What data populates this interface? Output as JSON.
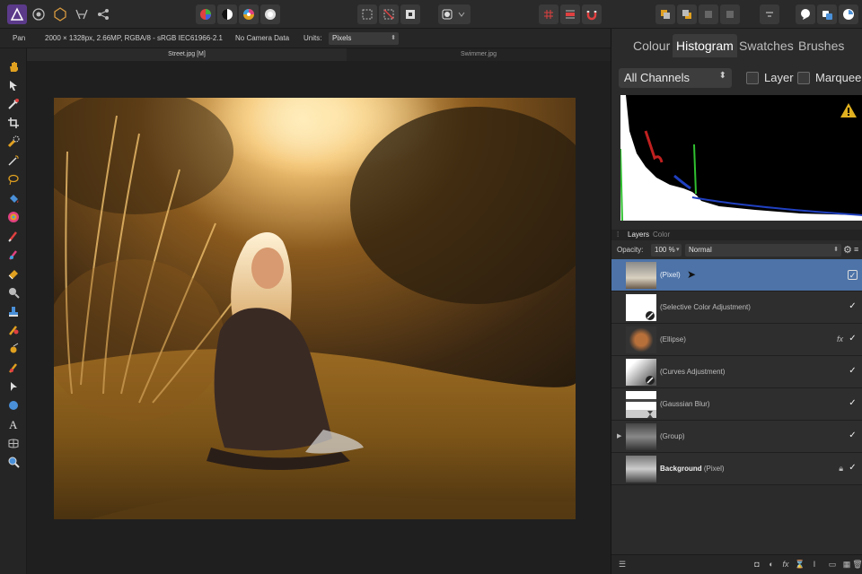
{
  "context_bar": {
    "tool": "Pan",
    "document_info": "2000 × 1328px, 2.66MP, RGBA/8 - sRGB IEC61966-2.1",
    "camera": "No Camera Data",
    "units_label": "Units:",
    "units_value": "Pixels"
  },
  "doc_tabs": [
    "Street.jpg [M]",
    "Swimmer.jpg"
  ],
  "panel_tabs": [
    "Colour",
    "Histogram",
    "Swatches",
    "Brushes"
  ],
  "histogram": {
    "channel": "All Channels",
    "layer_label": "Layer",
    "marquee_label": "Marquee",
    "warning_icon": "warning-triangle-icon"
  },
  "layers_panel": {
    "tabs": [
      "Layers",
      "Color"
    ],
    "opacity_label": "Opacity:",
    "opacity_value": "100 %",
    "blend_mode": "Normal",
    "layers": [
      {
        "name": "(Pixel)",
        "selected": true
      },
      {
        "name": "(Selective Color Adjustment)"
      },
      {
        "name": "(Ellipse)",
        "fx": "fx"
      },
      {
        "name": "(Curves Adjustment)"
      },
      {
        "name": "(Gaussian Blur)"
      },
      {
        "name": "(Group)"
      },
      {
        "name_bold": "Background",
        "name_suffix": " (Pixel)"
      }
    ]
  },
  "colors": {
    "selection": "#4d73a8",
    "panel_bg": "#2b2b2b",
    "accent_warning": "#e0b020"
  }
}
